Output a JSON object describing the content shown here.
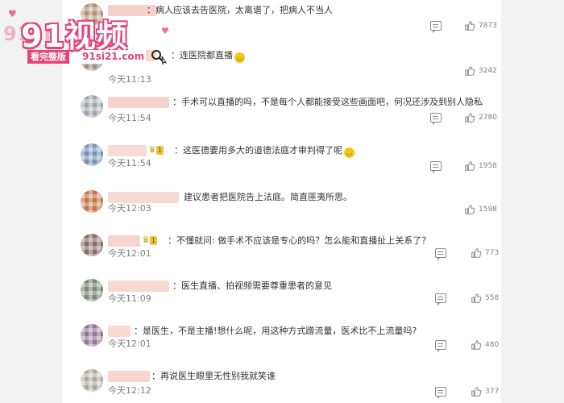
{
  "comments": [
    {
      "text": "病人应该去告医院，太离谱了，把病人不当人",
      "time": "",
      "likes": "7873",
      "avatar_color": "#c9a98c",
      "name_color": "#f4c9c0"
    },
    {
      "text": "连医院都直播",
      "time": "今天11:13",
      "likes": "3242",
      "avatar_color": "#b9a596",
      "name_color": "#f6d2c8",
      "emoji": true
    },
    {
      "text": "手术可以直播的吗，不是每个人都能接受这些画面吧，何况还涉及到别人隐私",
      "time": "今天11:54",
      "likes": "2780",
      "avatar_color": "#b8bcc6",
      "name_color": "#f5cdc5"
    },
    {
      "text": "这医德要用多大的道德法庭才审判得了呢",
      "time": "今天11:54",
      "likes": "1958",
      "avatar_color": "#8fa6cf",
      "name_color": "#f7d6cf",
      "vip_level": "1",
      "emoji": true
    },
    {
      "text": "建议患者把医院告上法庭。简直匪夷所思。",
      "time": "今天12:03",
      "likes": "1598",
      "avatar_color": "#d9885a",
      "name_color": "#f6d4cc"
    },
    {
      "text": "不懂就问: 做手术不应该是专心的吗？怎么能和直播扯上关系了？",
      "time": "今天12:01",
      "likes": "773",
      "avatar_color": "#9b7f78",
      "name_color": "#f5cec6",
      "vip_level": "1"
    },
    {
      "text": "医生直播、拍视频需要尊重患者的意见",
      "time": "今天11:09",
      "likes": "558",
      "avatar_color": "#8f9c86",
      "name_color": "#f6d2ca"
    },
    {
      "text": "是医生，不是主播!想什么呢，用这种方式蹭流量，医术比不上流量吗?",
      "time": "今天12:01",
      "likes": "480",
      "avatar_color": "#a68aa8",
      "name_color": "#f7d3cb"
    },
    {
      "text": "再说医生眼里无性别我就笑谁",
      "time": "今天12:12",
      "likes": "377",
      "avatar_color": "#c8c2b6",
      "name_color": "#f5cfc7"
    }
  ],
  "watermark": {
    "logo_ghost": "91sp",
    "logo": "91视频",
    "tag": "看完整版",
    "url": "91si21.com"
  },
  "icons": {
    "reply": "comment-bubble-icon",
    "like": "thumbs-up-icon",
    "search": "search-icon",
    "heart": "heart-icon"
  },
  "colors": {
    "text": "#333333",
    "meta": "#808080",
    "watermark_accent": "#e3437a"
  }
}
